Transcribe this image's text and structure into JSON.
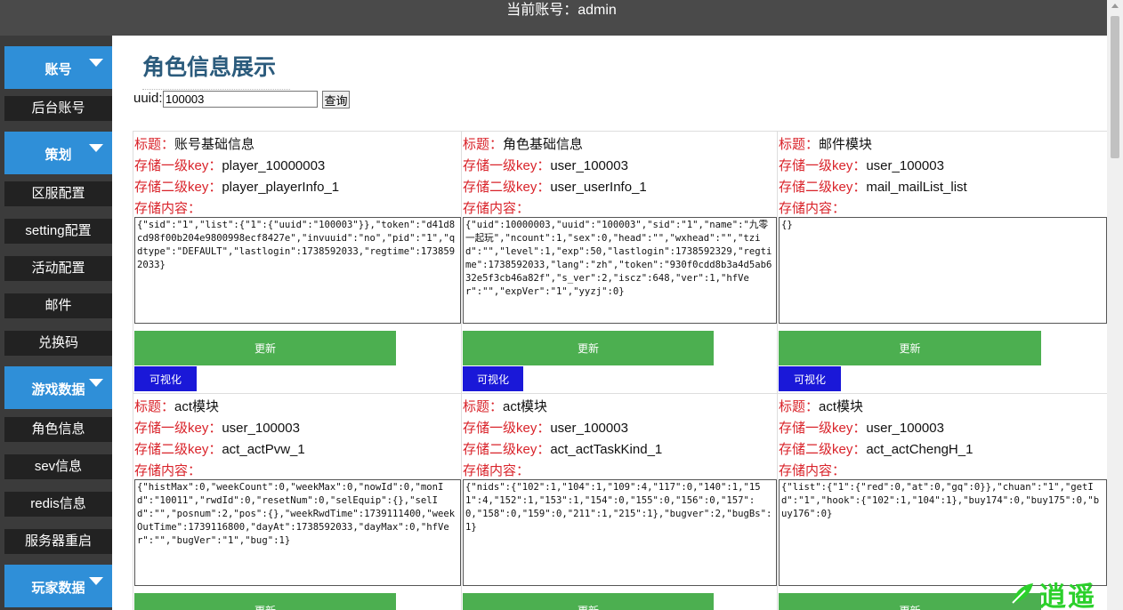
{
  "header": {
    "current_account": "当前账号：admin"
  },
  "sidebar": {
    "sections": [
      {
        "label": "账号",
        "items": [
          "后台账号"
        ]
      },
      {
        "label": "策划",
        "items": [
          "区服配置",
          "setting配置",
          "活动配置",
          "邮件",
          "兑换码"
        ]
      },
      {
        "label": "游戏数据",
        "items": [
          "角色信息",
          "sev信息",
          "redis信息",
          "服务器重启"
        ]
      },
      {
        "label": "玩家数据",
        "items": []
      }
    ]
  },
  "main": {
    "title": "角色信息展示",
    "search": {
      "label": "uuid:",
      "value": "100003",
      "button": "查询"
    },
    "labels": {
      "title": "标题：",
      "key1": "存储一级key：",
      "key2": "存储二级key：",
      "content": "存储内容：",
      "update": "更新",
      "visualize": "可视化"
    },
    "cards": [
      {
        "title": "账号基础信息",
        "key1": "player_10000003",
        "key2": "player_playerInfo_1",
        "content": "{\"sid\":\"1\",\"list\":{\"1\":{\"uuid\":\"100003\"}},\"token\":\"d41d8cd98f00b204e9800998ecf8427e\",\"invuuid\":\"no\",\"pid\":\"1\",\"qdtype\":\"DEFAULT\",\"lastlogin\":1738592033,\"regtime\":1738592033}"
      },
      {
        "title": "角色基础信息",
        "key1": "user_100003",
        "key2": "user_userInfo_1",
        "content": "{\"uid\":10000003,\"uuid\":\"100003\",\"sid\":\"1\",\"name\":\"九零一起玩\",\"ncount\":1,\"sex\":0,\"head\":\"\",\"wxhead\":\"\",\"tzid\":\"\",\"level\":1,\"exp\":50,\"lastlogin\":1738592329,\"regtime\":1738592033,\"lang\":\"zh\",\"token\":\"930f0cdd8b3a4d5ab632e5f3cb46a82f\",\"s_ver\":2,\"iscz\":648,\"ver\":1,\"hfVer\":\"\",\"expVer\":\"1\",\"yyzj\":0}"
      },
      {
        "title": "邮件模块",
        "key1": "user_100003",
        "key2": "mail_mailList_list",
        "content": "{}"
      },
      {
        "title": "act模块",
        "key1": "user_100003",
        "key2": "act_actPvw_1",
        "content": "{\"histMax\":0,\"weekCount\":0,\"weekMax\":0,\"nowId\":0,\"monId\":\"10011\",\"rwdId\":0,\"resetNum\":0,\"selEquip\":{},\"selId\":\"\",\"posnum\":2,\"pos\":{},\"weekRwdTime\":1739111400,\"weekOutTime\":1739116800,\"dayAt\":1738592033,\"dayMax\":0,\"hfVer\":\"\",\"bugVer\":\"1\",\"bug\":1}"
      },
      {
        "title": "act模块",
        "key1": "user_100003",
        "key2": "act_actTaskKind_1",
        "content": "{\"nids\":{\"102\":1,\"104\":1,\"109\":4,\"117\":0,\"140\":1,\"151\":4,\"152\":1,\"153\":1,\"154\":0,\"155\":0,\"156\":0,\"157\":0,\"158\":0,\"159\":0,\"211\":1,\"215\":1},\"bugver\":2,\"bugBs\":1}"
      },
      {
        "title": "act模块",
        "key1": "user_100003",
        "key2": "act_actChengH_1",
        "content": "{\"list\":{\"1\":{\"red\":0,\"at\":0,\"gq\":0}},\"chuan\":\"1\",\"getId\":\"1\",\"hook\":{\"102\":1,\"104\":1},\"buy174\":0,\"buy175\":0,\"buy176\":0}"
      }
    ]
  },
  "watermark": {
    "text": "逍遥"
  }
}
